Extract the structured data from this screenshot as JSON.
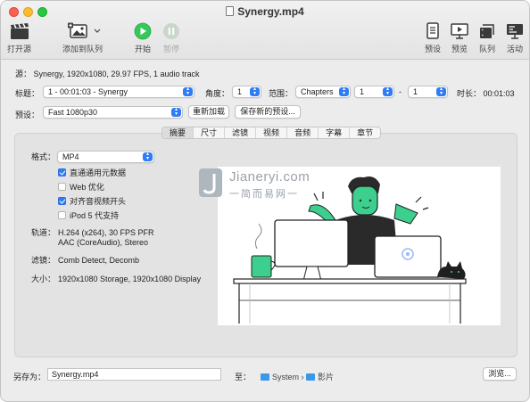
{
  "window": {
    "title": "Synergy.mp4"
  },
  "toolbar": {
    "open_source": "打开源",
    "add_to_queue": "添加到队列",
    "start": "开始",
    "pause": "暂停",
    "presets": "预设",
    "preview": "预览",
    "queue": "队列",
    "activity": "活动"
  },
  "source": {
    "label": "源：",
    "value": "Synergy, 1920x1080, 29.97 FPS, 1 audio track"
  },
  "title_row": {
    "title_label": "标题：",
    "title_value": "1 - 00:01:03 - Synergy",
    "angle_label": "角度：",
    "angle_value": "1",
    "range_label": "范围：",
    "range_type": "Chapters",
    "range_start": "1",
    "range_dash": "-",
    "range_end": "1",
    "duration_label": "时长：",
    "duration_value": "00:01:03"
  },
  "preset_row": {
    "label": "预设：",
    "value": "Fast 1080p30",
    "reload_button": "重新加载",
    "save_button": "保存新的预设..."
  },
  "tabs": [
    "摘要",
    "尺寸",
    "滤镜",
    "视频",
    "音频",
    "字幕",
    "章节"
  ],
  "summary": {
    "format_label": "格式：",
    "format_value": "MP4",
    "options": [
      {
        "label": "直通通用元数据",
        "checked": true
      },
      {
        "label": "Web 优化",
        "checked": false
      },
      {
        "label": "对齐音视频开头",
        "checked": true
      },
      {
        "label": "iPod 5 代支持",
        "checked": false
      }
    ],
    "tracks_label": "轨道：",
    "tracks_line1": "H.264 (x264), 30 FPS PFR",
    "tracks_line2": "AAC (CoreAudio), Stereo",
    "filters_label": "滤镜：",
    "filters_value": "Comb Detect, Decomb",
    "size_label": "大小：",
    "size_value": "1920x1080 Storage, 1920x1080 Display"
  },
  "watermark": {
    "text": "Jianeryi.com",
    "sub": "一简而易网一"
  },
  "bottom": {
    "save_as_label": "另存为：",
    "filename": "Synergy.mp4",
    "to_label": "至：",
    "path_1": "System",
    "path_sep": "›",
    "path_2": "影片",
    "browse_button": "浏览..."
  },
  "colors": {
    "accent": "#2f7cf6",
    "start_green": "#36c85a",
    "illustration_green": "#3dcf8e"
  }
}
